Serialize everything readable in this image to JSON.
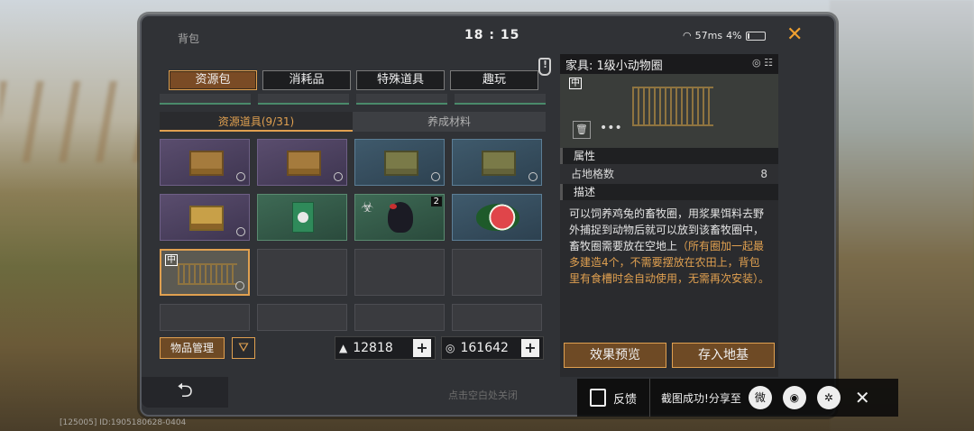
{
  "window": {
    "title": "背包",
    "time": "18 : 15",
    "network": "57ms",
    "battery": "4%"
  },
  "tabs": [
    {
      "label": "资源包",
      "active": true
    },
    {
      "label": "消耗品",
      "active": false
    },
    {
      "label": "特殊道具",
      "active": false
    },
    {
      "label": "趣玩",
      "active": false
    }
  ],
  "subtabs": [
    {
      "label": "资源道具(9/31)",
      "active": true
    },
    {
      "label": "养成材料",
      "active": false
    }
  ],
  "grid": {
    "rows": [
      [
        {
          "kind": "crate",
          "rarity": "purple"
        },
        {
          "kind": "crate",
          "rarity": "purple"
        },
        {
          "kind": "crate",
          "rarity": "blue"
        },
        {
          "kind": "crate",
          "rarity": "blue"
        }
      ],
      [
        {
          "kind": "crate",
          "rarity": "purple"
        },
        {
          "kind": "pack",
          "rarity": "green"
        },
        {
          "kind": "chicken",
          "rarity": "green",
          "count": "2"
        },
        {
          "kind": "watermelon",
          "rarity": "blue"
        }
      ]
    ],
    "selected_tag": "中",
    "chicken_count": "2"
  },
  "footer": {
    "manage_label": "物品管理",
    "filter_icon": "filter-icon",
    "currency1": "12818",
    "currency2": "161642",
    "hint": "点击空白处关闭"
  },
  "detail": {
    "title": "家具: 1级小动物圈",
    "tag": "中",
    "section_attr": "属性",
    "attr_label": "占地格数",
    "attr_value": "8",
    "section_desc": "描述",
    "desc_main": "可以饲养鸡兔的畜牧圈，用浆果饵料去野外捕捉到动物后就可以放到该畜牧圈中，畜牧圈需要放在空地上",
    "desc_orange": "（所有圈加一起最多建造4个，不需要摆放在农田上，背包里有食槽时会自动使用，无需再次安装）。",
    "btn_preview": "效果预览",
    "btn_store": "存入地基"
  },
  "share": {
    "feedback": "反馈",
    "text": "截图成功!分享至"
  },
  "debug": "[125005] ID:1905180628-0404"
}
